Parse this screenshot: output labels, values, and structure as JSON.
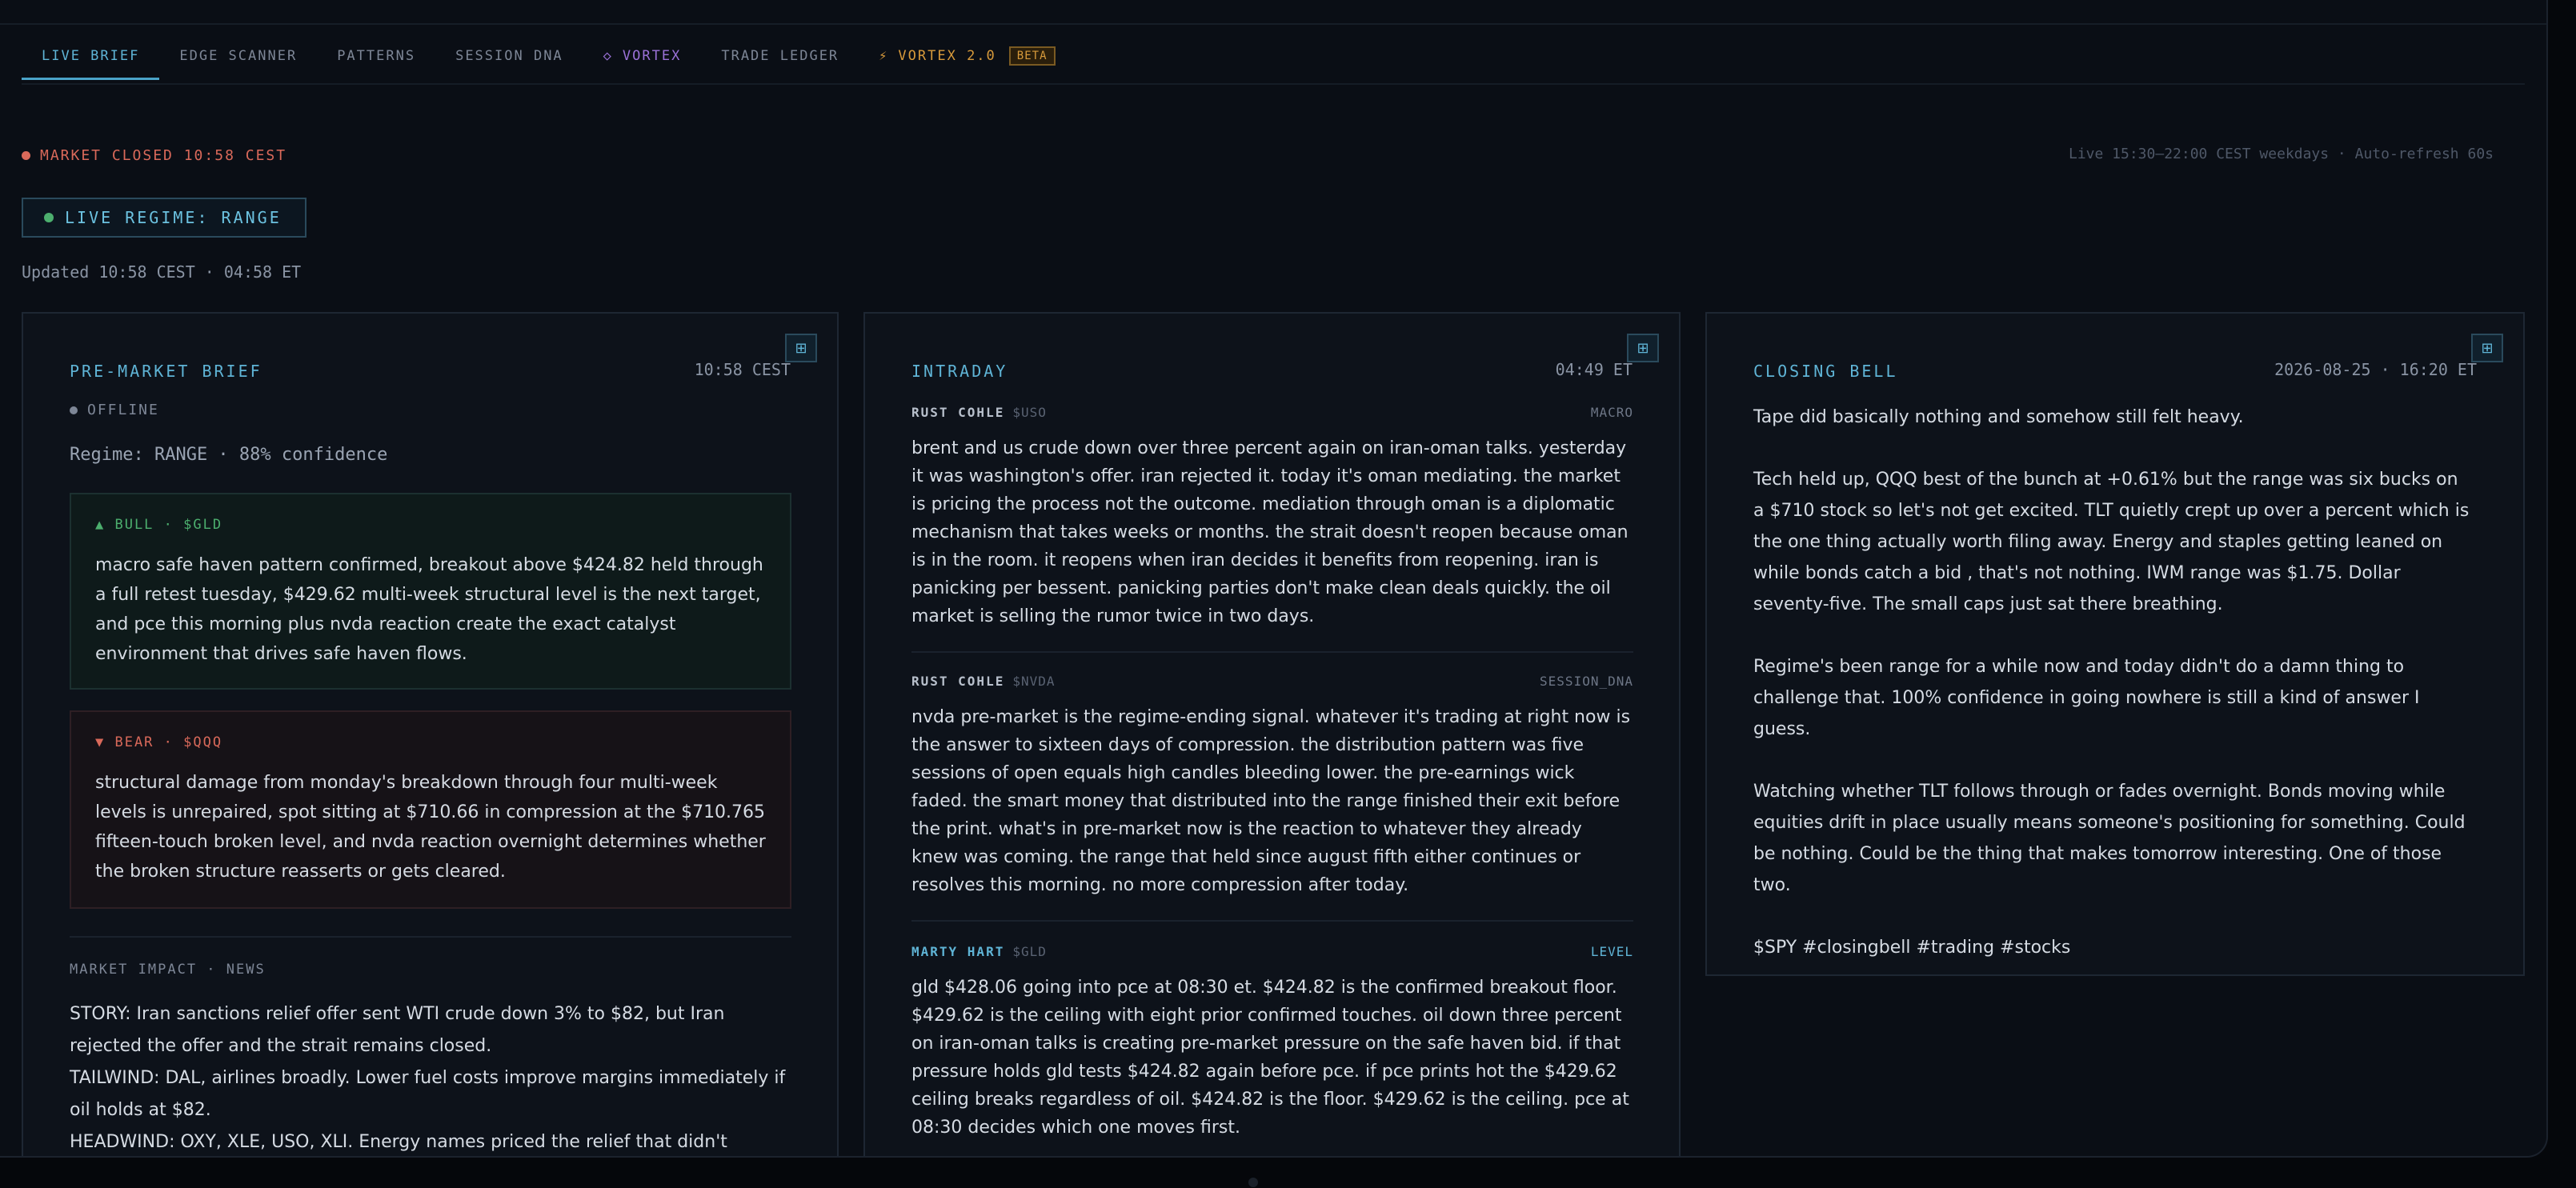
{
  "nav": {
    "tabs": [
      {
        "label": "LIVE BRIEF"
      },
      {
        "label": "EDGE SCANNER"
      },
      {
        "label": "PATTERNS"
      },
      {
        "label": "SESSION DNA"
      },
      {
        "label": "VORTEX",
        "icon": "◇"
      },
      {
        "label": "TRADE LEDGER"
      },
      {
        "label": "VORTEX 2.0",
        "icon": "⚡",
        "badge": "BETA"
      }
    ]
  },
  "status": {
    "market": "MARKET CLOSED 10:58 CEST",
    "market_color": "#d9695a",
    "live_hours": "Live 15:30–22:00 CEST weekdays · Auto-refresh 60s",
    "regime_badge": "LIVE REGIME: RANGE",
    "regime_color": "#4caf6e",
    "updated": "Updated 10:58 CEST · 04:58 ET"
  },
  "premarket": {
    "title": "PRE-MARKET BRIEF",
    "time": "10:58 CEST",
    "state": "OFFLINE",
    "regime": "Regime: RANGE · 88% confidence",
    "bull": {
      "label": "▲ BULL · $GLD",
      "text": "macro safe haven pattern confirmed, breakout above $424.82 held through a full retest tuesday, $429.62 multi-week structural level is the next target, and pce this morning plus nvda reaction create the exact catalyst environment that drives safe haven flows."
    },
    "bear": {
      "label": "▼ BEAR · $QQQ",
      "text": "structural damage from monday's breakdown through four multi-week levels is unrepaired, spot sitting at $710.66 in compression at the $710.765 fifteen-touch broken level, and nvda reaction overnight determines whether the broken structure reasserts or gets cleared."
    },
    "impact_title": "MARKET IMPACT · NEWS",
    "impact": [
      "STORY: Iran sanctions relief offer sent WTI crude down 3% to $82, but Iran rejected the offer and the strait remains closed.",
      "TAILWIND: DAL, airlines broadly. Lower fuel costs improve margins immediately if oil holds at $82.",
      "HEADWIND: OXY, XLE, USO, XLI. Energy names priced the relief that didn't happen."
    ]
  },
  "intraday": {
    "title": "INTRADAY",
    "time": "04:49 ET",
    "posts": [
      {
        "author": "RUST COHLE",
        "ticker": "$USO",
        "tag": "MACRO",
        "text": "brent and us crude down over three percent again on iran-oman talks. yesterday it was washington's offer. iran rejected it. today it's oman mediating. the market is pricing the process not the outcome. mediation through oman is a diplomatic mechanism that takes weeks or months. the strait doesn't reopen because oman is in the room. it reopens when iran decides it benefits from reopening. iran is panicking per bessent. panicking parties don't make clean deals quickly. the oil market is selling the rumor twice in two days."
      },
      {
        "author": "RUST COHLE",
        "ticker": "$NVDA",
        "tag": "SESSION_DNA",
        "text": "nvda pre-market is the regime-ending signal. whatever it's trading at right now is the answer to sixteen days of compression. the distribution pattern was five sessions of open equals high candles bleeding lower. the pre-earnings wick faded. the smart money that distributed into the range finished their exit before the print. what's in pre-market now is the reaction to whatever they already knew was coming. the range that held since august fifth either continues or resolves this morning. no more compression after today."
      },
      {
        "author": "MARTY HART",
        "ticker": "$GLD",
        "tag": "LEVEL",
        "text": "gld $428.06 going into pce at 08:30 et. $424.82 is the confirmed breakout floor. $429.62 is the ceiling with eight prior confirmed touches. oil down three percent on iran-oman talks is creating pre-market pressure on the safe haven bid. if that pressure holds gld tests $424.82 again before pce. if pce prints hot the $429.62 ceiling breaks regardless of oil. $424.82 is the floor. $429.62 is the ceiling. pce at 08:30 decides which one moves first."
      }
    ]
  },
  "closing": {
    "title": "CLOSING BELL",
    "time": "2026-08-25 · 16:20 ET",
    "paragraphs": [
      "Tape did basically nothing and somehow still felt heavy.",
      "Tech held up, QQQ best of the bunch at +0.61% but the range was six bucks on a $710 stock so let's not get excited. TLT quietly crept up over a percent which is the one thing actually worth filing away. Energy and staples getting leaned on while bonds catch a bid , that's not nothing. IWM range was $1.75. Dollar seventy-five. The small caps just sat there breathing.",
      "Regime's been range for a while now and today didn't do a damn thing to challenge that. 100% confidence in going nowhere is still a kind of answer I guess.",
      "Watching whether TLT follows through or fades overnight. Bonds moving while equities drift in place usually means someone's positioning for something. Could be nothing. Could be the thing that makes tomorrow interesting. One of those two.",
      "$SPY #closingbell #trading #stocks"
    ]
  }
}
